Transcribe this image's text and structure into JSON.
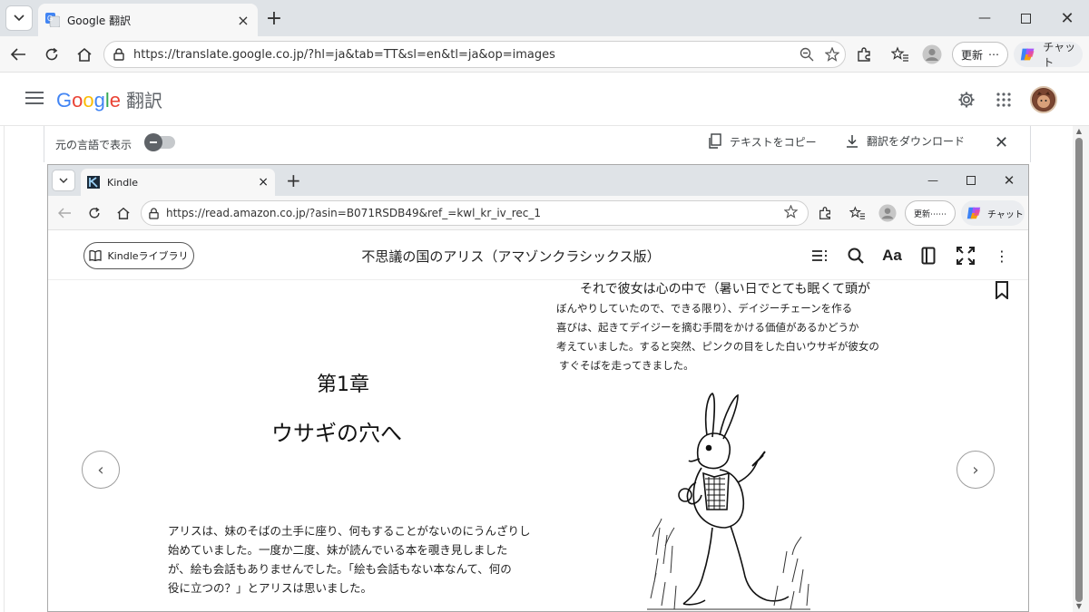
{
  "browser": {
    "tab_title": "Google 翻訳",
    "url": "https://translate.google.co.jp/?hl=ja&tab=TT&sl=en&tl=ja&op=images",
    "update_label": "更新",
    "chat_label": "チャット"
  },
  "translate": {
    "logo": {
      "g1": "G",
      "g2": "o",
      "g3": "o",
      "g4": "g",
      "g5": "l",
      "g6": "e"
    },
    "product": "翻訳",
    "show_original_label": "元の言語で表示",
    "copy_text_label": "テキストをコピー",
    "download_label": "翻訳をダウンロード"
  },
  "embedded_browser": {
    "tab_title": "Kindle",
    "url": "https://read.amazon.co.jp/?asin=B071RSDB49&ref_=kwl_kr_iv_rec_1",
    "update_label": "更新⋯⋯",
    "chat_label": "チャット"
  },
  "kindle": {
    "library_label": "Kindleライブラリ",
    "book_title": "不思議の国のアリス（アマゾンクラシックス版）",
    "font_button": "Aa",
    "chapter_number": "第1章",
    "chapter_title": "ウサギの穴へ",
    "left_paragraph": [
      "アリスは、妹のそばの土手に座り、何もすることがないのにうんざりし",
      "始めていました。一度か二度、妹が読んでいる本を覗き見しました",
      "が、絵も会話もありませんでした。「絵も会話もない本なんて、何の",
      "役に立つの？」とアリスは思いました。"
    ],
    "right_lead": "それで彼女は心の中で（暑い日でとても眠くて頭が",
    "right_paragraph": [
      "ぼんやりしていたので、できる限り）、デイジーチェーンを作る",
      "喜びは、起きてデイジーを摘む手間をかける価値があるかどうか",
      "考えていました。すると突然、ピンクの目をした白いウサギが彼女の",
      "すぐそばを走ってきました。"
    ],
    "prev_glyph": "‹",
    "next_glyph": "›"
  },
  "colors": {
    "google_blue": "#4285F4",
    "google_red": "#EA4335",
    "google_yellow": "#FBBC05",
    "google_green": "#34A853"
  }
}
